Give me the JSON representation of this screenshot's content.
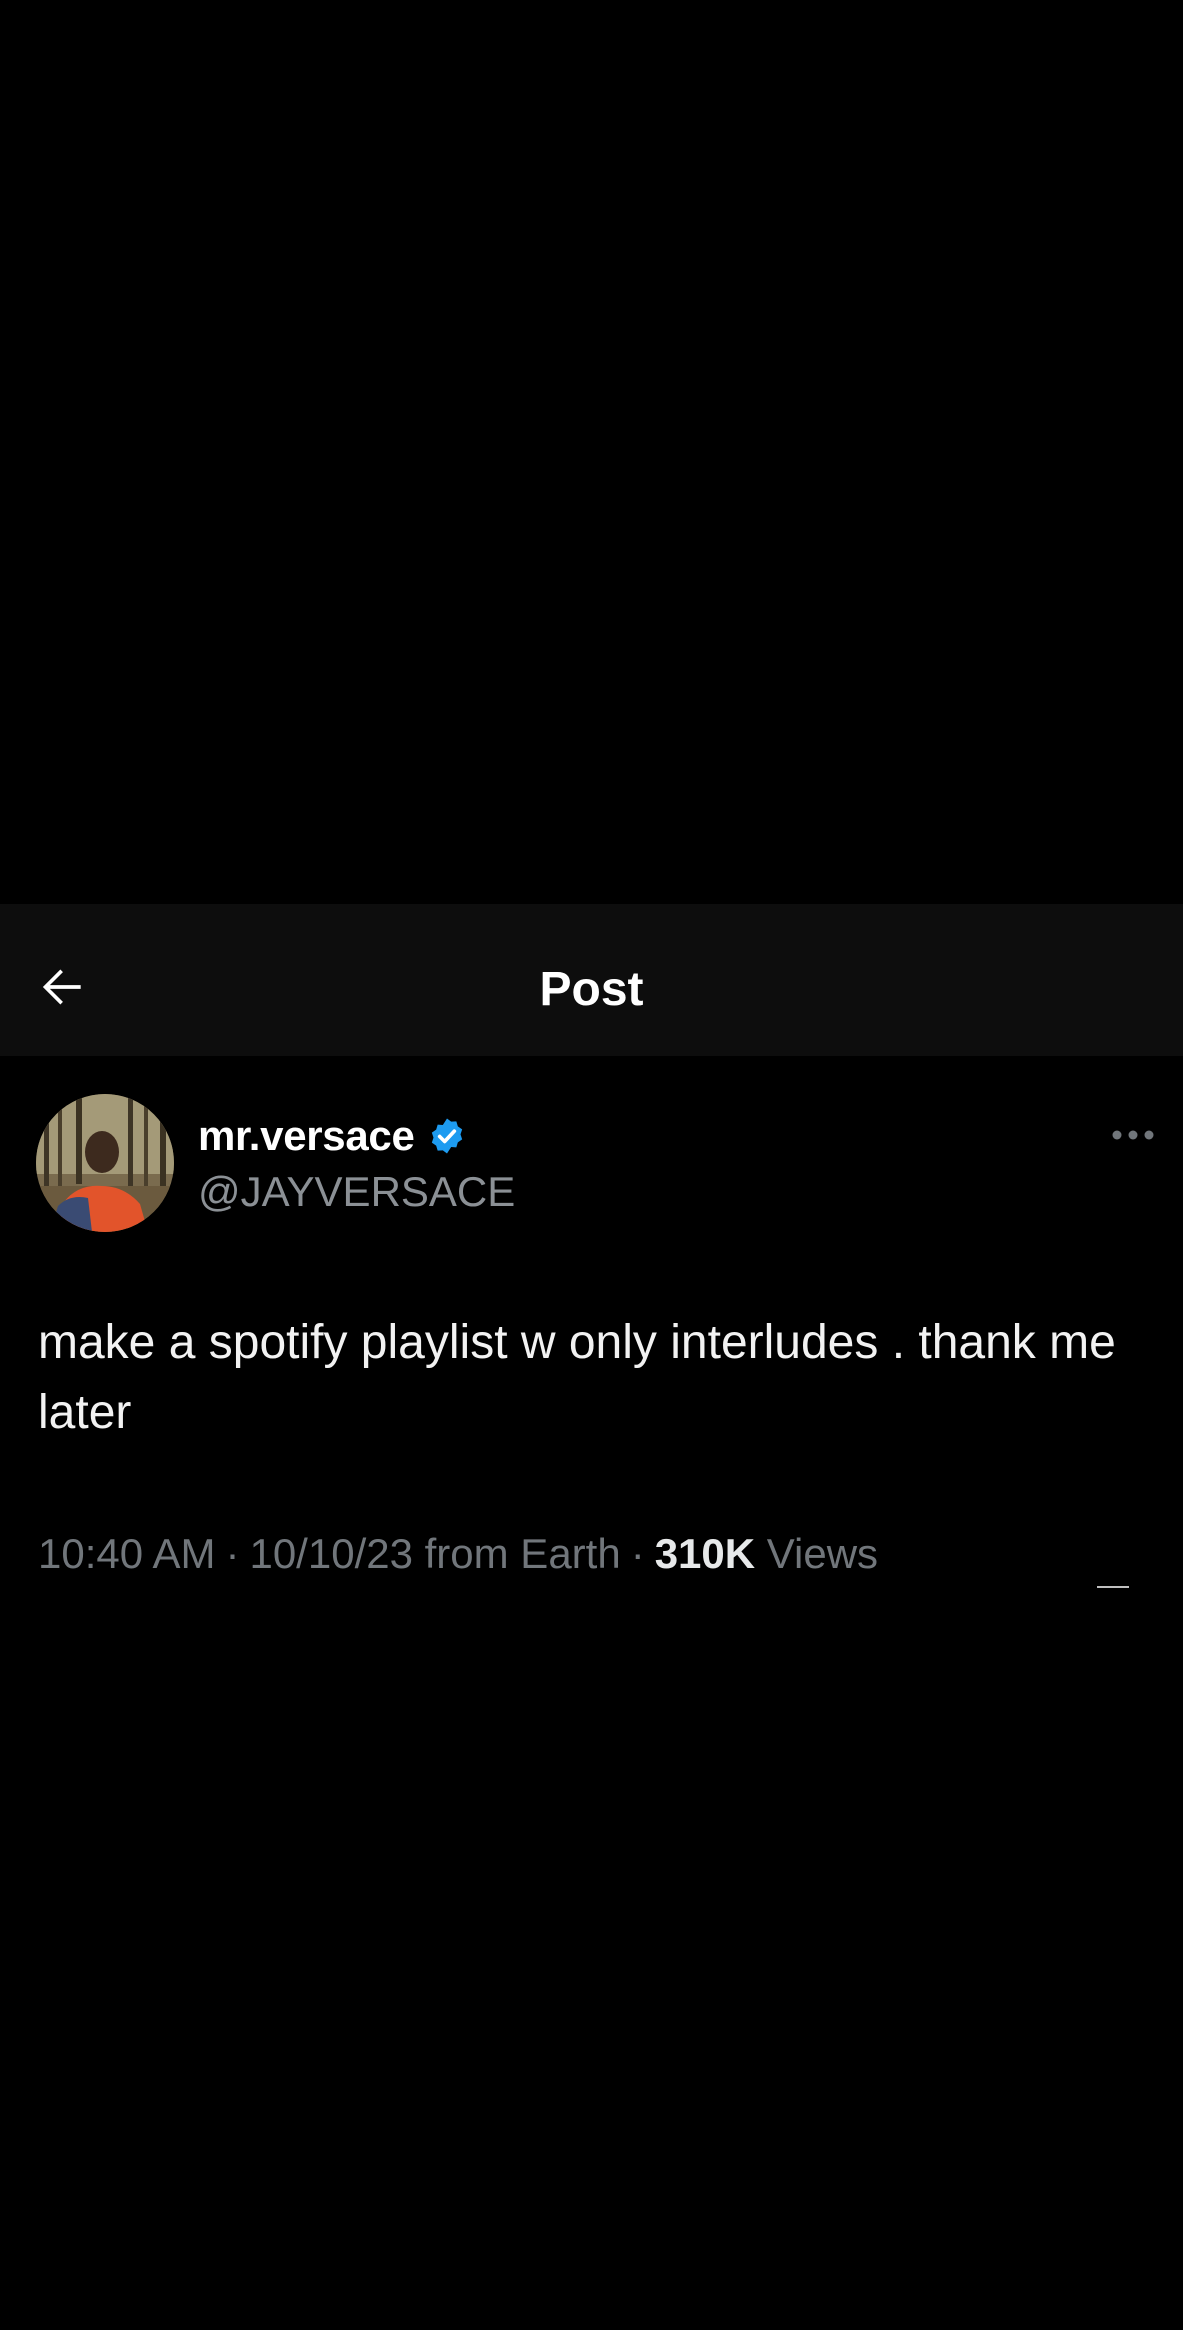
{
  "header": {
    "title": "Post",
    "back_icon": "arrow-left-icon"
  },
  "post": {
    "author": {
      "display_name": "mr.versace",
      "handle": "@JAYVERSACE",
      "verified": true,
      "verified_color": "#1d9bf0"
    },
    "text": "make a spotify playlist w only interludes . thank me later",
    "time": "10:40 AM",
    "date": "10/10/23",
    "source": "from Earth",
    "separator": "·",
    "views_count": "310K",
    "views_label": "Views"
  },
  "colors": {
    "background": "#000000",
    "header_background": "#0d0d0d",
    "primary_text": "#ffffff",
    "secondary_text": "#71767b",
    "accent": "#1d9bf0"
  }
}
